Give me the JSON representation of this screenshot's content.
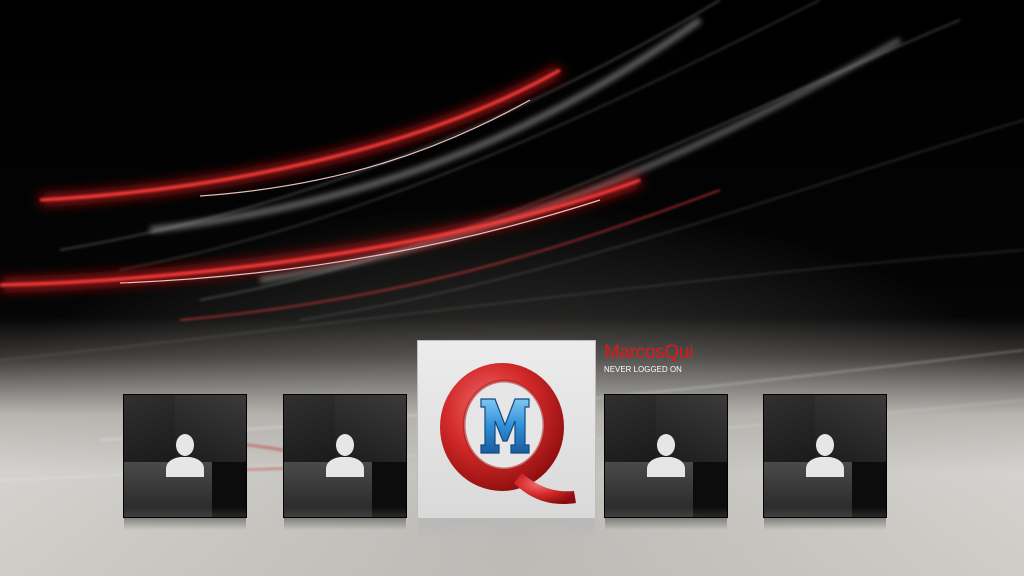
{
  "users": [
    {
      "name": "",
      "status": "",
      "icon": "generic-user-icon",
      "selected": false
    },
    {
      "name": "",
      "status": "",
      "icon": "generic-user-icon",
      "selected": false
    },
    {
      "name": "MarcosQui",
      "status": "NEVER LOGGED ON",
      "icon": "qm-logo-icon",
      "selected": true
    },
    {
      "name": "",
      "status": "",
      "icon": "generic-user-icon",
      "selected": false
    },
    {
      "name": "",
      "status": "",
      "icon": "generic-user-icon",
      "selected": false
    }
  ],
  "selected_user": {
    "name": "MarcosQui",
    "status": "NEVER LOGGED ON"
  },
  "colors": {
    "accent_red": "#e01818",
    "background_top": "#000000",
    "background_bottom": "#d8d6d2",
    "status_text": "#ffffff"
  }
}
